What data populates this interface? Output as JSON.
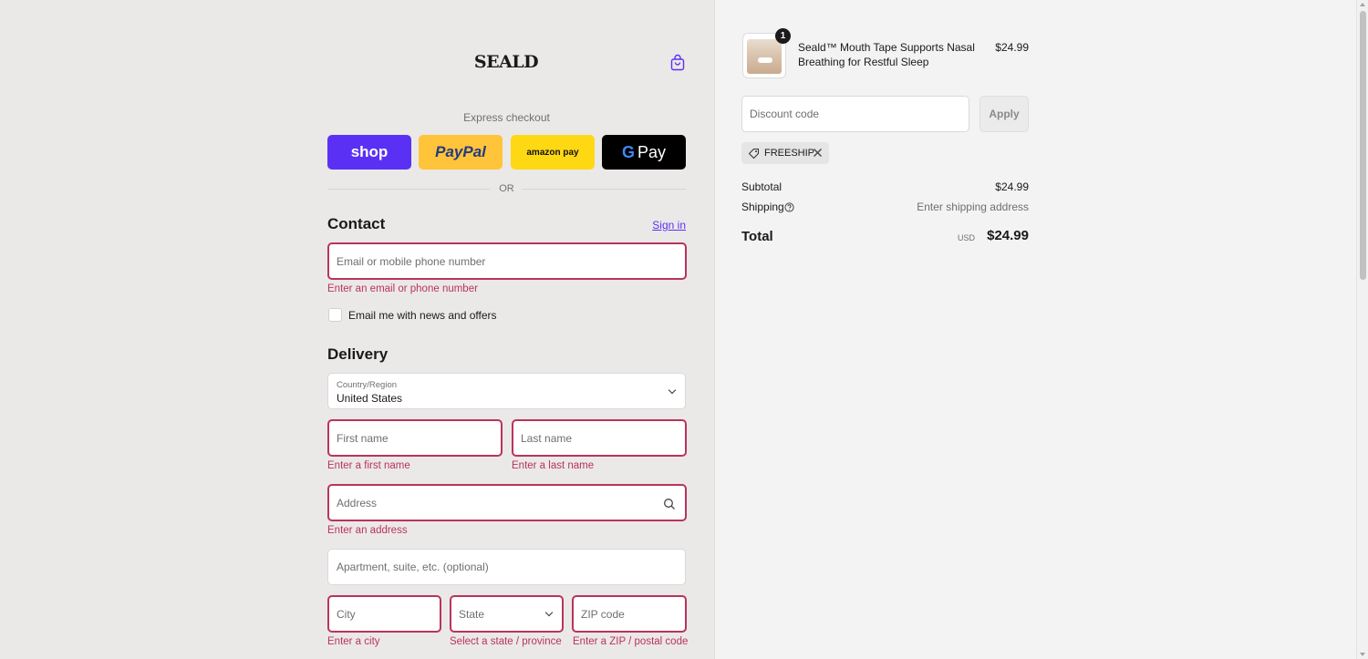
{
  "header": {
    "logo": "SEALD",
    "cart_icon": "shopping-bag-icon"
  },
  "express": {
    "label": "Express checkout",
    "shop_label": "shop",
    "paypal_label": "PayPal",
    "amazon_label": "amazon pay",
    "gpay_g": "G",
    "gpay_label": "Pay",
    "or_label": "OR"
  },
  "contact": {
    "title": "Contact",
    "signin": "Sign in",
    "email_placeholder": "Email or mobile phone number",
    "email_error": "Enter an email or phone number",
    "newsletter_label": "Email me with news and offers"
  },
  "delivery": {
    "title": "Delivery",
    "country_label": "Country/Region",
    "country_value": "United States",
    "first_name_placeholder": "First name",
    "first_name_error": "Enter a first name",
    "last_name_placeholder": "Last name",
    "last_name_error": "Enter a last name",
    "address_placeholder": "Address",
    "address_error": "Enter an address",
    "apartment_placeholder": "Apartment, suite, etc. (optional)",
    "city_placeholder": "City",
    "city_error": "Enter a city",
    "state_placeholder": "State",
    "state_error": "Select a state / province",
    "zip_placeholder": "ZIP code",
    "zip_error": "Enter a ZIP / postal code"
  },
  "summary": {
    "product": {
      "quantity": "1",
      "name": "Seald™ Mouth Tape Supports Nasal Breathing for Restful Sleep",
      "price": "$24.99"
    },
    "discount_placeholder": "Discount code",
    "apply_label": "Apply",
    "discount_tag": "FREESHIP",
    "subtotal_label": "Subtotal",
    "subtotal_value": "$24.99",
    "shipping_label": "Shipping",
    "shipping_value": "Enter shipping address",
    "total_label": "Total",
    "total_currency": "USD",
    "total_value": "$24.99"
  },
  "colors": {
    "error": "#b8345c",
    "shop_brand": "#5a31f4",
    "paypal_brand": "#ffc439",
    "amazon_brand": "#ffd814"
  }
}
